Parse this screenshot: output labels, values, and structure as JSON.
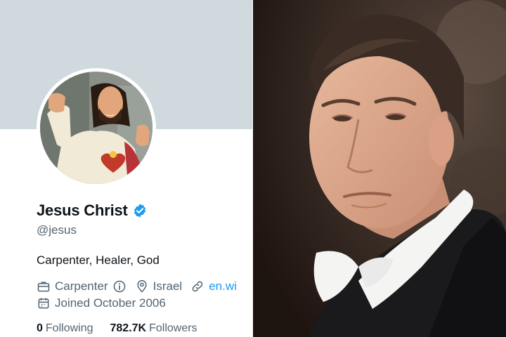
{
  "profile": {
    "name": "Jesus Christ",
    "verified": true,
    "handle": "@jesus",
    "bio": "Carpenter, Healer, God",
    "profession": "Carpenter",
    "location": "Israel",
    "website": "en.wi",
    "joined": "Joined October 2006",
    "following_count": "0",
    "following_label": "Following",
    "followers_count": "782.7K",
    "followers_label": "Followers"
  },
  "icons": {
    "verified": "verified-badge-icon",
    "profession": "briefcase-icon",
    "info": "info-icon",
    "location": "location-pin-icon",
    "website": "link-icon",
    "joined": "calendar-icon"
  },
  "colors": {
    "banner": "#cfd9de",
    "verified": "#1d9bf0",
    "link": "#1d9bf0",
    "primary_text": "#0f1419",
    "secondary_text": "#536471"
  }
}
